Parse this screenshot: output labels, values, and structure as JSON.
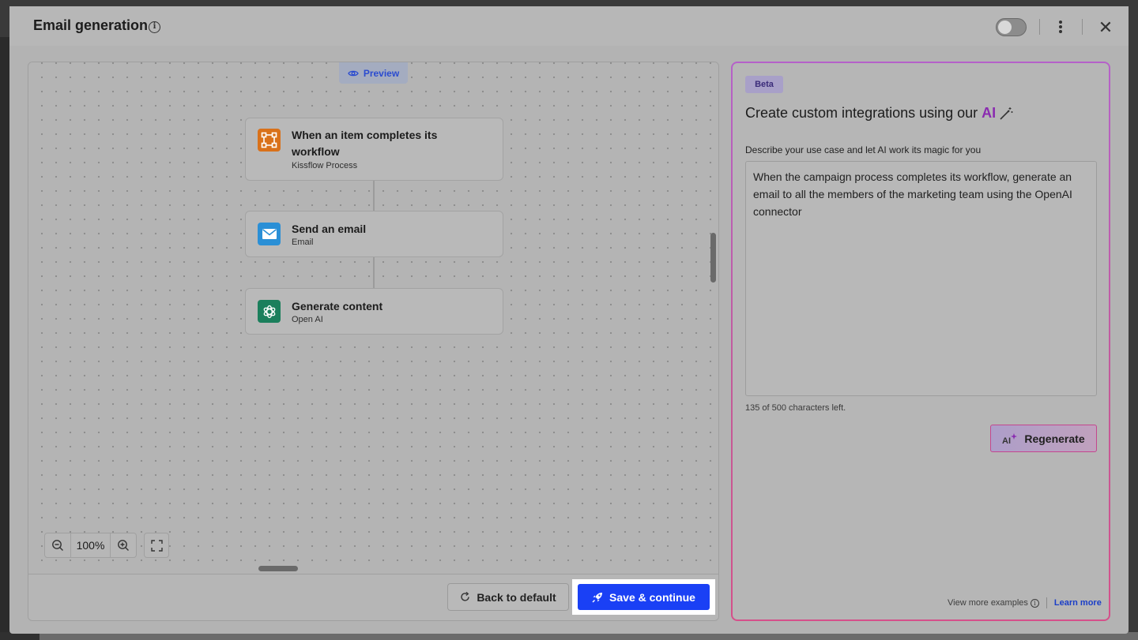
{
  "modal": {
    "title": "Email generation",
    "info_icon": "info-icon",
    "close_glyph": "✕"
  },
  "canvas": {
    "preview_label": "Preview",
    "nodes": [
      {
        "title": "When an item completes its workflow",
        "subtitle": "Kissflow Process",
        "icon": "kissflow-process-icon",
        "color": "#d9711a"
      },
      {
        "title": "Send an email",
        "subtitle": "Email",
        "icon": "email-icon",
        "color": "#2a8fd6"
      },
      {
        "title": "Generate content",
        "subtitle": "Open AI",
        "icon": "openai-icon",
        "color": "#1b7f5c"
      }
    ],
    "zoom_level": "100%"
  },
  "footer": {
    "back_label": "Back to default",
    "save_label": "Save & continue"
  },
  "ai_panel": {
    "badge": "Beta",
    "heading_prefix": "Create custom integrations using our",
    "heading_highlight": "AI",
    "description_label": "Describe your use case and let AI work its magic for you",
    "prompt_text": "When the campaign process completes its workflow, generate an email to all the members of the marketing team using the OpenAI connector",
    "char_count": "135 of 500 characters left.",
    "regenerate_label": "Regenerate",
    "view_more_label": "View more examples",
    "learn_more_label": "Learn more"
  },
  "colors": {
    "primary": "#1a40f5",
    "ai_accent": "#8a2bb0",
    "link": "#1a3ec8"
  }
}
